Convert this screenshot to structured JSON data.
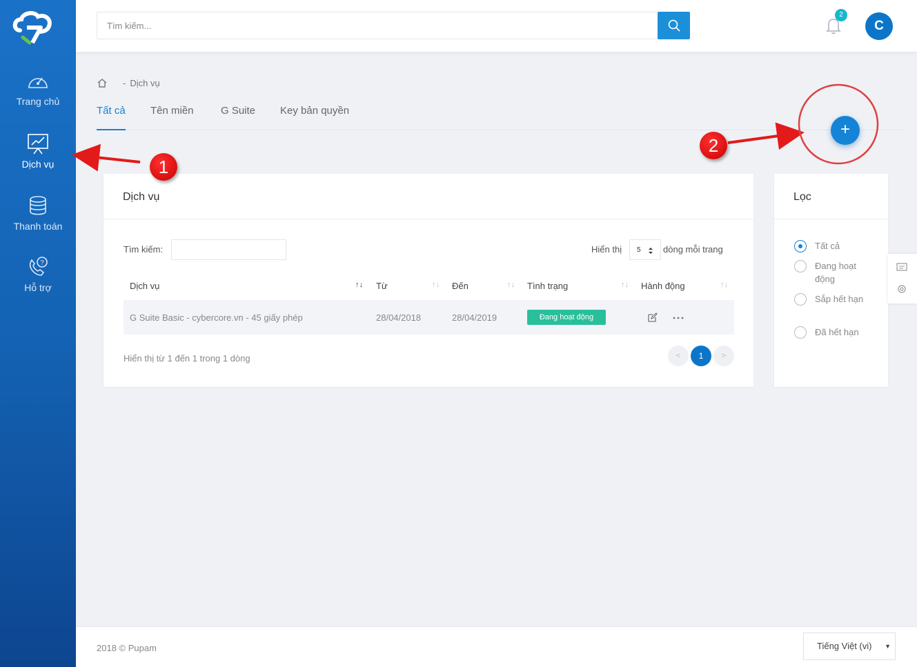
{
  "sidebar": {
    "items": [
      {
        "label": "Trang chủ",
        "icon": "dashboard-gauge-icon"
      },
      {
        "label": "Dịch vụ",
        "icon": "presentation-chart-icon",
        "active": true
      },
      {
        "label": "Thanh toán",
        "icon": "coins-stack-icon"
      },
      {
        "label": "Hỗ trợ",
        "icon": "phone-question-icon"
      }
    ]
  },
  "header": {
    "search_placeholder": "Tìm kiếm...",
    "notification_count": "2",
    "avatar_initial": "C"
  },
  "breadcrumb": {
    "separator": "-",
    "current": "Dịch vụ"
  },
  "tabs": [
    {
      "label": "Tất cả",
      "active": true
    },
    {
      "label": "Tên miền"
    },
    {
      "label": "G Suite"
    },
    {
      "label": "Key bản quyền"
    }
  ],
  "fab_label": "+",
  "services_card": {
    "title": "Dịch vụ",
    "search_label": "Tìm kiếm:",
    "show_label": "Hiển thị",
    "page_size": "5",
    "per_page_label": "dòng mỗi trang",
    "columns": [
      "Dịch vụ",
      "Từ",
      "Đến",
      "Tình trạng",
      "Hành động"
    ],
    "rows": [
      {
        "service": "G Suite Basic - cybercore.vn - 45 giấy phép",
        "from": "28/04/2018",
        "to": "28/04/2019",
        "status": "Đang hoạt động"
      }
    ],
    "summary": "Hiển thị từ 1 đến 1 trong 1 dòng",
    "pagination": {
      "prev": "<",
      "current": "1",
      "next": ">"
    }
  },
  "filter_card": {
    "title": "Lọc",
    "options": [
      {
        "label": "Tất cả",
        "checked": true
      },
      {
        "label": "Đang hoạt động"
      },
      {
        "label": "Sắp hết hạn"
      },
      {
        "label": "Đã hết hạn"
      }
    ]
  },
  "annotations": [
    "1",
    "2"
  ],
  "footer": {
    "copyright": "2018 © Pupam",
    "language": "Tiếng Việt (vi)"
  },
  "colors": {
    "primary": "#1a80d0",
    "sidebar": "#1567bb",
    "status_active": "#29bf9a",
    "annotation": "#e01010"
  }
}
